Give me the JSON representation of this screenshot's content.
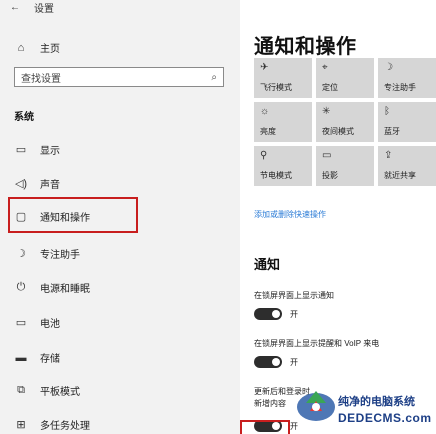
{
  "window": {
    "back_glyph": "←",
    "title": "设置"
  },
  "sidebar": {
    "home_label": "主页",
    "search_placeholder": "查找设置",
    "section_label": "系统",
    "items": [
      {
        "icon": "monitor-icon",
        "label": "显示"
      },
      {
        "icon": "speaker-icon",
        "label": "声音"
      },
      {
        "icon": "notification-icon",
        "label": "通知和操作",
        "selected": true
      },
      {
        "icon": "moon-icon",
        "label": "专注助手"
      },
      {
        "icon": "power-icon",
        "label": "电源和睡眠"
      },
      {
        "icon": "battery-icon",
        "label": "电池"
      },
      {
        "icon": "storage-icon",
        "label": "存储"
      },
      {
        "icon": "tablet-icon",
        "label": "平板模式"
      },
      {
        "icon": "multitask-icon",
        "label": "多任务处理"
      }
    ]
  },
  "main": {
    "title": "通知和操作",
    "quick_actions": [
      {
        "icon": "airplane-icon",
        "label": "飞行模式"
      },
      {
        "icon": "location-icon",
        "label": "定位"
      },
      {
        "icon": "focus-icon",
        "label": "专注助手"
      },
      {
        "icon": "brightness-icon",
        "label": "亮度"
      },
      {
        "icon": "night-light-icon",
        "label": "夜间模式"
      },
      {
        "icon": "bluetooth-icon",
        "label": "蓝牙"
      },
      {
        "icon": "location-icon",
        "label": "节电模式"
      },
      {
        "icon": "project-icon",
        "label": "投影"
      },
      {
        "icon": "share-icon",
        "label": "就近共享"
      }
    ],
    "edit_link": "添加或删除快速操作",
    "notifications_header": "通知",
    "settings": [
      {
        "label": "在锁屏界面上显示通知",
        "toggle": "开"
      },
      {
        "label": "在锁屏界面上显示提醒和 VoIP 来电",
        "toggle": "开"
      },
      {
        "label_line1": "更新后和登录时",
        "label_line2": "新增内容",
        "toggle": "开"
      }
    ]
  },
  "watermark": {
    "line1": "纯净的电脑系统",
    "line2": "DEDECMS.com"
  }
}
